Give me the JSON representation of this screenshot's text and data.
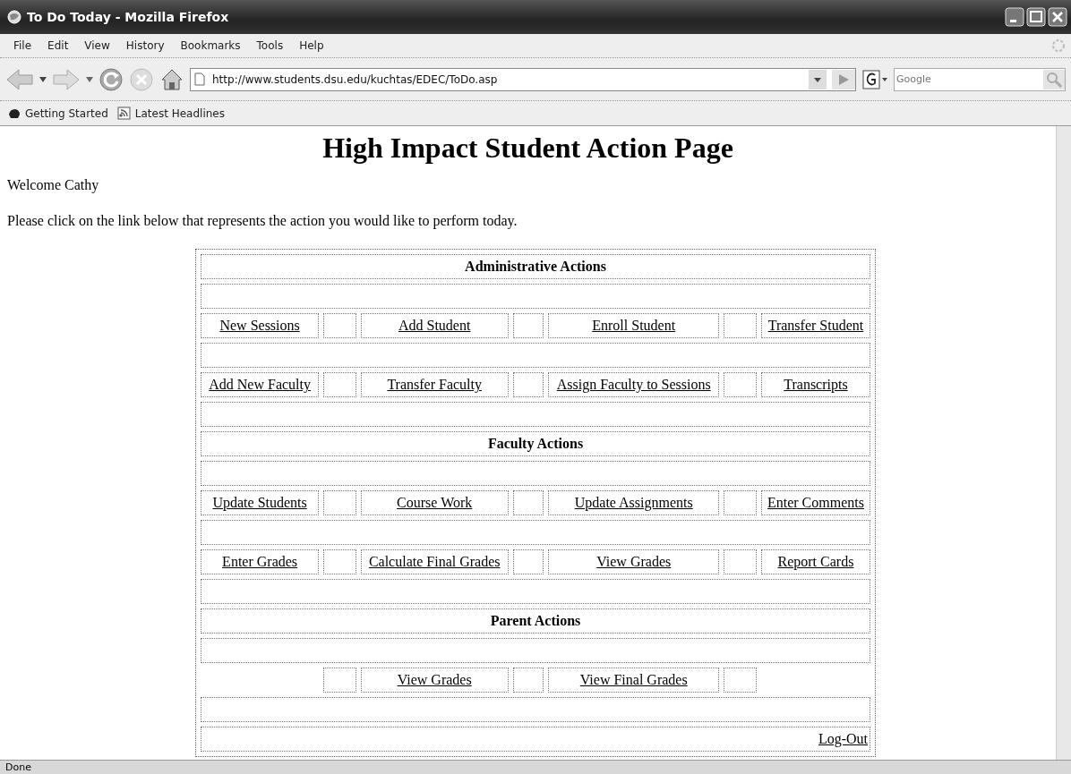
{
  "window": {
    "title": "To Do Today - Mozilla Firefox"
  },
  "menu": [
    "File",
    "Edit",
    "View",
    "History",
    "Bookmarks",
    "Tools",
    "Help"
  ],
  "address_bar": {
    "value": "http://www.students.dsu.edu/kuchtas/EDEC/ToDo.asp"
  },
  "search": {
    "placeholder": "Google"
  },
  "bookmarks": [
    "Getting Started",
    "Latest Headlines"
  ],
  "page": {
    "heading": "High Impact Student Action Page",
    "welcome": "Welcome Cathy",
    "instruction": "Please click on the link below that represents the action you would like to perform today.",
    "rows": [
      {
        "kind": "heading",
        "label": "Administrative Actions"
      },
      {
        "kind": "spacer"
      },
      {
        "kind": "links",
        "links": [
          "New Sessions",
          "Add Student",
          "Enroll Student",
          "Transfer Student"
        ]
      },
      {
        "kind": "spacer"
      },
      {
        "kind": "links",
        "links": [
          "Add New Faculty",
          "Transfer Faculty",
          "Assign Faculty to Sessions",
          "Transcripts"
        ]
      },
      {
        "kind": "spacer"
      },
      {
        "kind": "heading",
        "label": "Faculty Actions"
      },
      {
        "kind": "spacer"
      },
      {
        "kind": "links",
        "links": [
          "Update Students",
          "Course Work",
          "Update Assignments",
          "Enter Comments"
        ]
      },
      {
        "kind": "spacer"
      },
      {
        "kind": "links",
        "links": [
          "Enter Grades",
          "Calculate Final Grades",
          "View Grades",
          "Report Cards"
        ]
      },
      {
        "kind": "spacer"
      },
      {
        "kind": "heading",
        "label": "Parent Actions"
      },
      {
        "kind": "spacer"
      },
      {
        "kind": "middle_links",
        "links": [
          "View Grades",
          "View Final Grades"
        ]
      },
      {
        "kind": "spacer"
      },
      {
        "kind": "logout",
        "label": "Log-Out"
      }
    ]
  },
  "status_bar": {
    "text": "Done"
  }
}
